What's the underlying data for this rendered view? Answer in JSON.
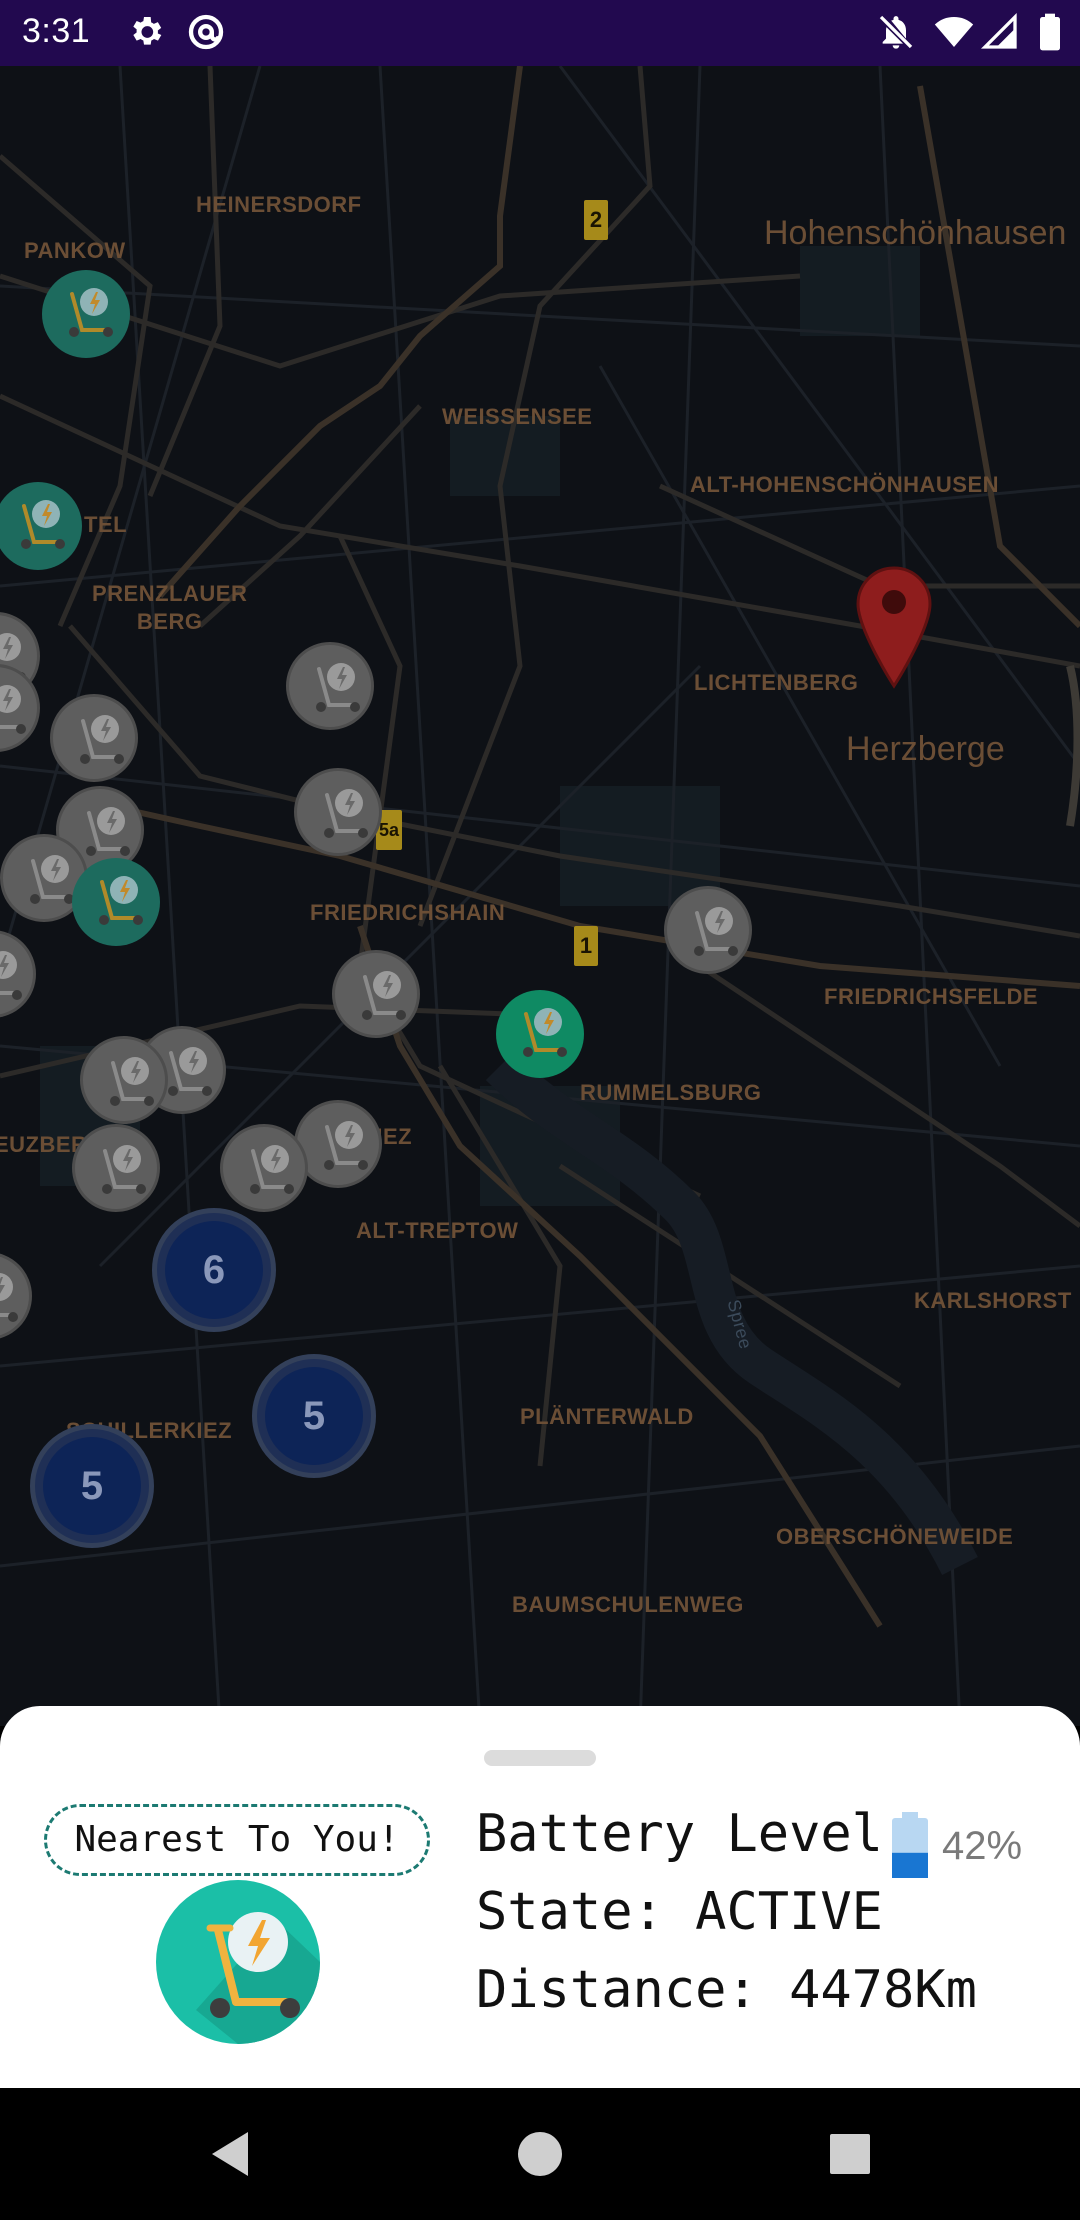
{
  "status_bar": {
    "time": "3:31",
    "left_icons": [
      "settings-gear-icon",
      "at-sign-icon"
    ],
    "right_icons": [
      "notifications-off-icon",
      "wifi-icon",
      "signal-icon",
      "battery-icon"
    ],
    "background": "#22094f"
  },
  "map": {
    "theme": "dark",
    "labels": {
      "heinersdorf": "HEINERSDORF",
      "pankow": "PANKOW",
      "hohenschonhausen": "Hohenschönhausen",
      "weissensee": "WEISSENSEE",
      "alt_hohenschonhausen": "ALT-HOHENSCHÖNHAUSEN",
      "tel": "TEL",
      "prenzlauer": "PRENZLAUER\nBERG",
      "lichtenberg": "LICHTENBERG",
      "herzberge": "Herzberge",
      "friedrichshain": "FRIEDRICHSHAIN",
      "friedrichsfelde": "FRIEDRICHSFELDE",
      "rummelsburg": "RUMMELSBURG",
      "uzber": "EUZBER",
      "kiez": "KIEZ",
      "alt_treptow": "ALT-TREPTOW",
      "karlshorst": "KARLSHORST",
      "spree": "Spree",
      "planterwald": "PLÄNTERWALD",
      "schillerkiez": "SCHILLERKIEZ",
      "oberschoneweide": "OBERSCHÖNEWEIDE",
      "baumschulenweg": "BAUMSCHULENWEG"
    },
    "route_shields": [
      "2",
      "1",
      "5a"
    ],
    "clusters": [
      "6",
      "5",
      "5"
    ],
    "scooter_markers": {
      "available_count": 4,
      "inactive_count": 16
    }
  },
  "sheet": {
    "nearest_label": "Nearest To You!",
    "battery_label": "Battery Level",
    "battery_percent": "42%",
    "battery_level": 0.42,
    "state_line": "State: ACTIVE",
    "distance_line": "Distance: 4478Km",
    "accent_color": "#1c7a72",
    "battery_color": "#1976d2"
  },
  "nav_bar": {
    "buttons": [
      "back-icon",
      "home-icon",
      "recents-icon"
    ]
  }
}
